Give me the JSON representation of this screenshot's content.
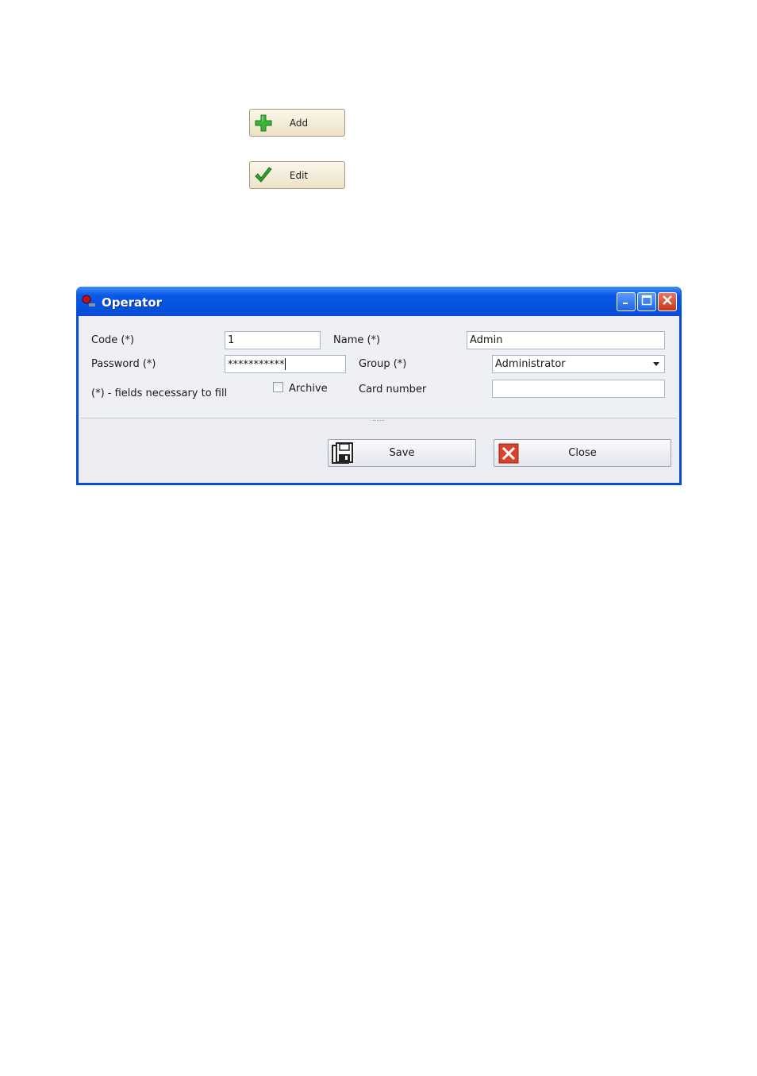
{
  "toolbar": {
    "add_label": "Add",
    "edit_label": "Edit"
  },
  "window": {
    "title": "Operator"
  },
  "form": {
    "code_label": "Code (*)",
    "code_value": "1",
    "name_label": "Name (*)",
    "name_value": "Admin",
    "password_label": "Password (*)",
    "password_value": "***********",
    "group_label": "Group (*)",
    "group_value": "Administrator",
    "required_note": "(*) - fields necessary to fill",
    "archive_label": "Archive",
    "archive_checked": false,
    "card_number_label": "Card number",
    "card_number_value": ""
  },
  "actions": {
    "save_label": "Save",
    "close_label": "Close"
  },
  "icons": {
    "add": "plus-icon",
    "edit": "checkmark-icon",
    "app": "app-icon",
    "save": "floppy-disk-icon",
    "close": "close-x-icon"
  },
  "colors": {
    "titlebar": "#0a4ad6",
    "add_icon": "#3ab53a",
    "edit_icon": "#2aa52a",
    "close_icon": "#d9432b"
  }
}
